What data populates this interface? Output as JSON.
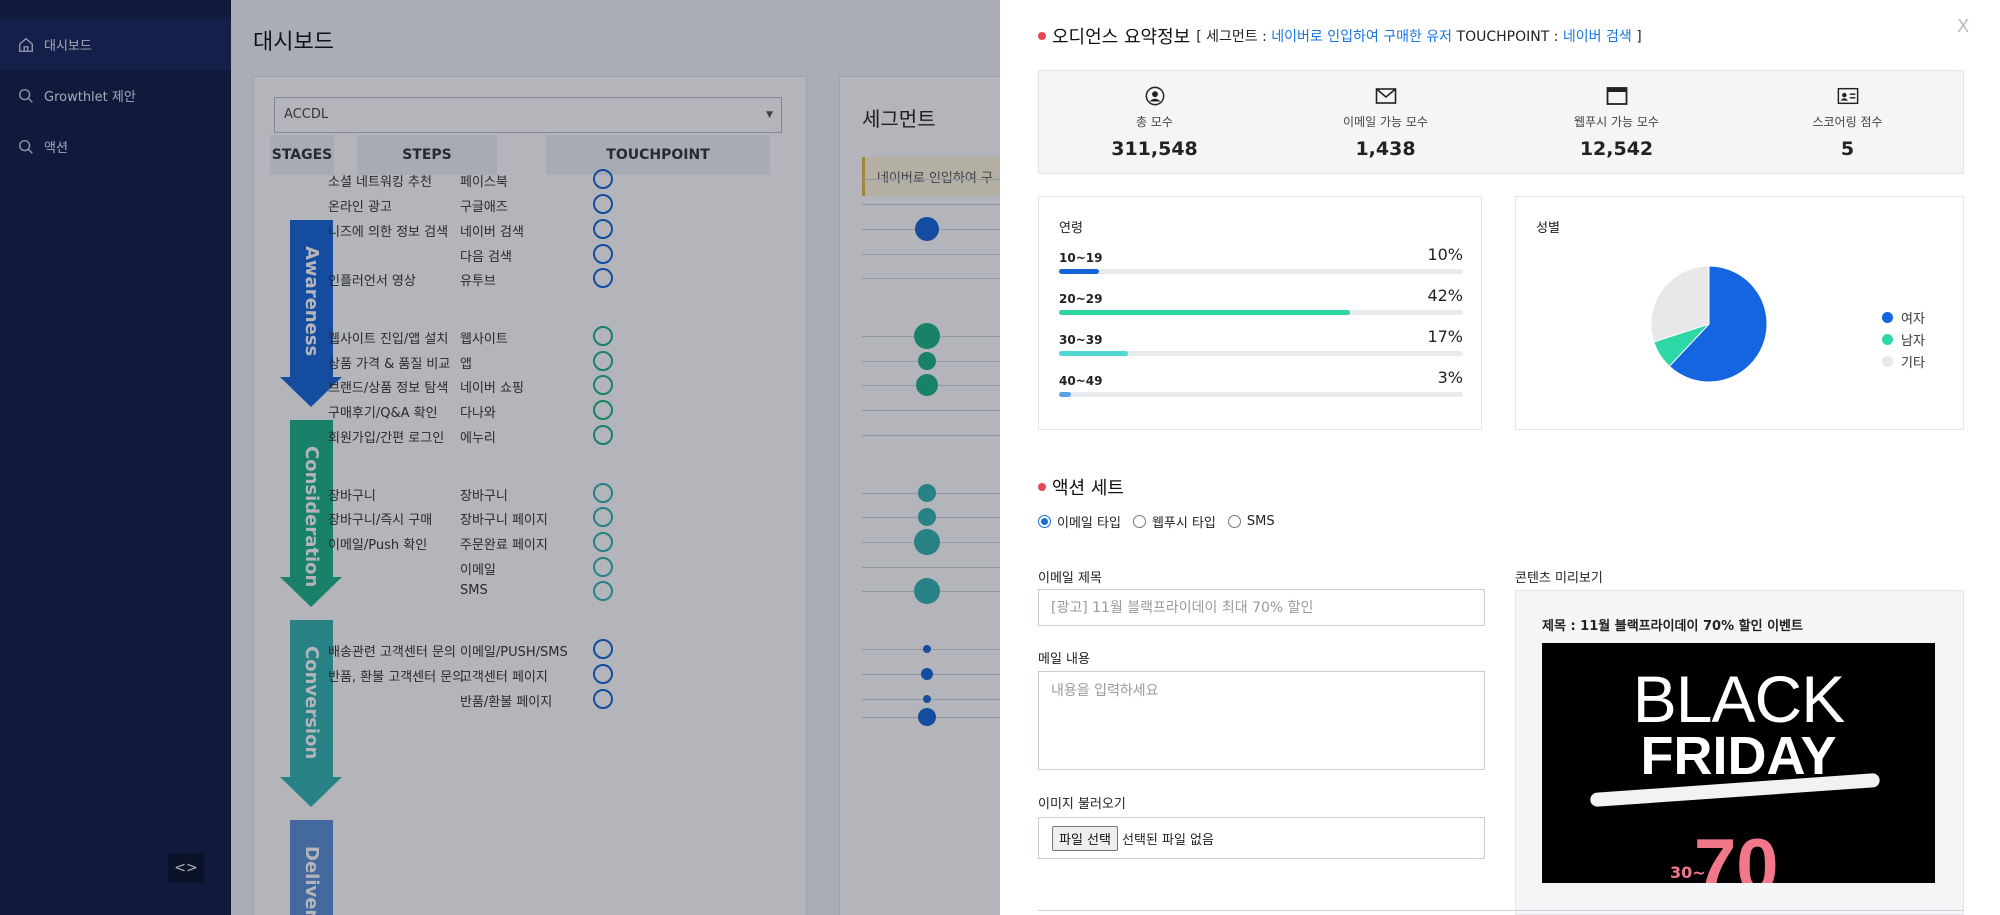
{
  "sidebar": {
    "items": [
      {
        "label": "대시보드",
        "icon": "home-icon"
      },
      {
        "label": "Growthlet 제안",
        "icon": "search-icon"
      },
      {
        "label": "액션",
        "icon": "search-icon"
      }
    ],
    "code_toggle": "<>"
  },
  "dashboard": {
    "title": "대시보드",
    "select_value": "ACCDL",
    "headers": [
      "STAGES",
      "STEPS",
      "TOUCHPOINT"
    ],
    "stages": [
      {
        "name": "Awareness",
        "color": "#1565d8"
      },
      {
        "name": "Consideration",
        "color": "#1db389"
      },
      {
        "name": "Conversion",
        "color": "#33b3b0"
      },
      {
        "name": "Delivery",
        "color": "#5a8fd8"
      }
    ],
    "rows": [
      {
        "step": "소셜 네트워킹 추천",
        "touchpoint": "페이스북"
      },
      {
        "step": "온라인 광고",
        "touchpoint": "구글애즈"
      },
      {
        "step": "니즈에 의한 정보 검색",
        "touchpoint": "네이버 검색"
      },
      {
        "step": "",
        "touchpoint": "다음 검색"
      },
      {
        "step": "인플러언서 영상",
        "touchpoint": "유투브"
      },
      {
        "step": "웹사이트 진입/앱 설치",
        "touchpoint": "웹사이트"
      },
      {
        "step": "상품 가격 & 품질 비교",
        "touchpoint": "앱"
      },
      {
        "step": "브랜드/상품 정보 탐색",
        "touchpoint": "네이버 쇼핑"
      },
      {
        "step": "구매후기/Q&A 확인",
        "touchpoint": "다나와"
      },
      {
        "step": "회원가입/간편 로그인",
        "touchpoint": "에누리"
      },
      {
        "step": "장바구니",
        "touchpoint": "장바구니"
      },
      {
        "step": "장바구니/즉시 구매",
        "touchpoint": "장바구니 페이지"
      },
      {
        "step": "이메일/Push 확인",
        "touchpoint": "주문완료 페이지"
      },
      {
        "step": "",
        "touchpoint": "이메일"
      },
      {
        "step": "",
        "touchpoint": "SMS"
      },
      {
        "step": "배송관련 고객센터 문의",
        "touchpoint": "이메일/PUSH/SMS"
      },
      {
        "step": "반품, 환불 고객센터 문의",
        "touchpoint": "고객센터 페이지"
      },
      {
        "step": "",
        "touchpoint": "반품/환불 페이지"
      }
    ],
    "segment_title": "세그먼트",
    "segment_tag": "네이버로 인입하여 구"
  },
  "panel": {
    "close": "X",
    "audience_title": "오디언스 요약정보",
    "segment_prefix": "[ 세그먼트 :",
    "segment_value": "네이버로 인입하여 구매한 유저",
    "touchpoint_prefix": "TOUCHPOINT :",
    "touchpoint_value": "네이버 검색",
    "suffix": "]",
    "stats": [
      {
        "label": "총 모수",
        "value": "311,548",
        "icon": "user-circle-icon"
      },
      {
        "label": "이메일 가능 모수",
        "value": "1,438",
        "icon": "envelope-icon"
      },
      {
        "label": "웹푸시 가능 모수",
        "value": "12,542",
        "icon": "browser-window-icon"
      },
      {
        "label": "스코어링 점수",
        "value": "5",
        "icon": "id-card-icon"
      }
    ],
    "age": {
      "title": "연령",
      "rows": [
        {
          "label": "10~19",
          "pct": "10%",
          "value": 0.1,
          "color": "#1565d8"
        },
        {
          "label": "20~29",
          "pct": "42%",
          "value": 0.72,
          "color": "#2bd6a3"
        },
        {
          "label": "30~39",
          "pct": "17%",
          "value": 0.17,
          "color": "#4fd9d4"
        },
        {
          "label": "40~49",
          "pct": "3%",
          "value": 0.03,
          "color": "#5aa2e8"
        }
      ]
    },
    "gender": {
      "title": "성별",
      "slices": [
        {
          "label": "여자",
          "value": 0.62,
          "color": "#1565e0"
        },
        {
          "label": "남자",
          "value": 0.08,
          "color": "#2ed8a6"
        },
        {
          "label": "기타",
          "value": 0.3,
          "color": "#e8e8ea"
        }
      ]
    },
    "action_title": "액션 세트",
    "radio_options": [
      "이메일 타입",
      "웹푸시 타입",
      "SMS"
    ],
    "selected_radio": "이메일 타입",
    "email_subject_label": "이메일 제목",
    "email_subject_placeholder": "[광고] 11월 블랙프라이데이 최대 70% 할인",
    "mail_body_label": "메일 내용",
    "mail_body_placeholder": "내용을 입력하세요",
    "image_label": "이미지 불러오기",
    "file_button": "파일 선택",
    "file_status": "선택된 파일 없음",
    "preview_label": "콘텐츠 미리보기",
    "preview_title": "제목 : 11월 블랙프라이데이 70% 할인 이벤트",
    "promo_line1": "BLACK",
    "promo_line2": "FRIDAY",
    "promo_prefix": "30~",
    "promo_pct": "70"
  }
}
